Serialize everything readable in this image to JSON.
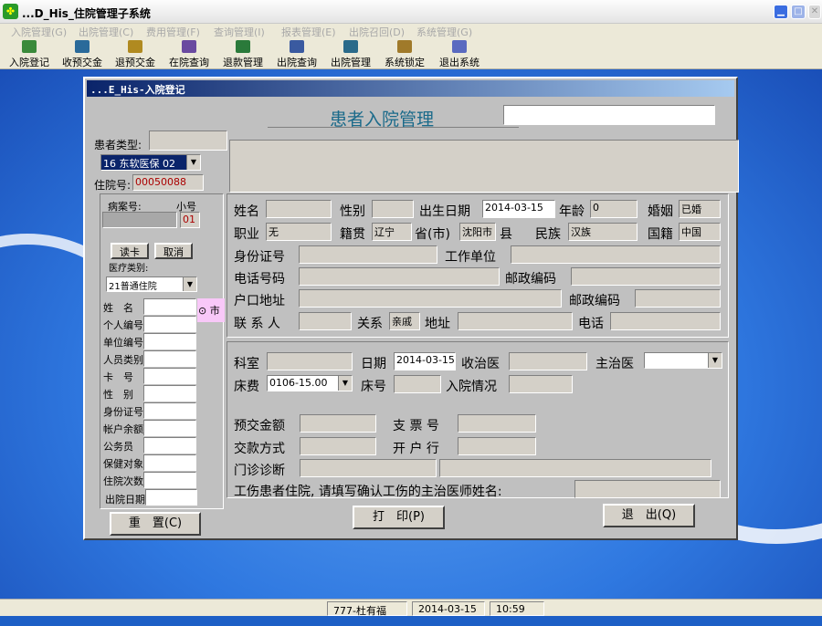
{
  "window": {
    "title": "...D_His_住院管理子系统",
    "min": "▁",
    "max": "□",
    "close": "✕"
  },
  "menu": [
    "入院管理(G)",
    "出院管理(C)",
    "费用管理(F)",
    "查询管理(I)",
    "报表管理(E)",
    "出院召回(D)",
    "系统管理(G)"
  ],
  "toolbar": [
    {
      "label": "入院登记",
      "icon": "register-icon",
      "color": "#3a8a3a"
    },
    {
      "label": "收预交金",
      "icon": "deposit-icon",
      "color": "#2a6a9a"
    },
    {
      "label": "退预交金",
      "icon": "refund-icon",
      "color": "#b08a20"
    },
    {
      "label": "在院查询",
      "icon": "inpatient-query-icon",
      "color": "#6a4aa0"
    },
    {
      "label": "退款管理",
      "icon": "refund-manage-icon",
      "color": "#2a7a3a"
    },
    {
      "label": "出院查询",
      "icon": "discharge-query-icon",
      "color": "#3a5aa0"
    },
    {
      "label": "出院管理",
      "icon": "discharge-manage-icon",
      "color": "#2a6a8a"
    },
    {
      "label": "系统锁定",
      "icon": "lock-icon",
      "color": "#a07a2a"
    },
    {
      "label": "退出系统",
      "icon": "exit-icon",
      "color": "#5a6ac0"
    }
  ],
  "dialog": {
    "title": "...E_His-入院登记",
    "heading": "患者入院管理",
    "heading_input": ""
  },
  "left": {
    "patient_type_label": "患者类型:",
    "patient_type_value": "",
    "patient_type_select": "16 东软医保 02",
    "admission_no_label": "住院号:",
    "admission_no": "00050088",
    "case_no_label": "病案号:",
    "sub_no_label": "小号",
    "case_no": "",
    "sub_no": "01",
    "read_card": "读卡",
    "cancel": "取消",
    "med_type_label": "医疗类别:",
    "med_type": "21普通住院",
    "city_radio": "市",
    "fields": [
      "姓　名",
      "个人编号",
      "单位编号",
      "人员类别",
      "卡　号",
      "性　别",
      "身份证号",
      "帐户余额",
      "公务员",
      "保健对象",
      "住院次数"
    ],
    "discharge_date_label": "出院日期"
  },
  "patient": {
    "name_label": "姓名",
    "gender_label": "性别",
    "birth_label": "出生日期",
    "birth": "2014-03-15",
    "age_label": "年龄",
    "age": "0",
    "marriage_label": "婚姻",
    "marriage": "已婚",
    "job_label": "职业",
    "job": "无",
    "native_label": "籍贯",
    "native": "辽宁",
    "province_label": "省(市)",
    "city": "沈阳市",
    "county_label": "县",
    "ethnic_label": "民族",
    "ethnic": "汉族",
    "nation_label": "国籍",
    "nation": "中国",
    "id_label": "身份证号",
    "work_label": "工作单位",
    "phone_label": "电话号码",
    "postcode_label": "邮政编码",
    "hukou_label": "户口地址",
    "postcode2_label": "邮政编码",
    "contact_label": "联 系 人",
    "relation_label": "关系",
    "relation": "亲戚",
    "address_label": "地址",
    "tel_label": "电话"
  },
  "admission": {
    "dept_label": "科室",
    "date_label": "日期",
    "date": "2014-03-15",
    "doctor_label": "收治医",
    "attending_label": "主治医",
    "bed_fee_label": "床费",
    "bed_fee": "0106-15.00",
    "bed_no_label": "床号",
    "status_label": "入院情况",
    "prepay_label": "预交金额",
    "check_label": "支 票 号",
    "pay_method_label": "交款方式",
    "bank_label": "开 户 行",
    "diagnosis_label": "门诊诊断",
    "injury_label": "工伤患者住院, 请填写确认工伤的主治医师姓名:"
  },
  "buttons": {
    "reset": "重　置(C)",
    "print": "打　印(P)",
    "exit": "退　出(Q)"
  },
  "status": {
    "user": "777-杜有福",
    "date": "2014-03-15",
    "time": "10:59"
  }
}
